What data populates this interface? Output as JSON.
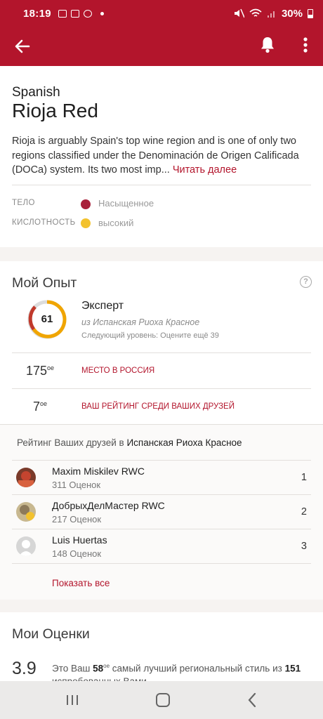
{
  "status_bar": {
    "time": "18:19",
    "battery": "30%"
  },
  "wine": {
    "origin": "Spanish",
    "name": "Rioja Red",
    "description": "Rioja is arguably Spain's top wine region and is one of only two regions classified under the Denominación de Origen Calificada (DOCa) system. Its two most imp...",
    "read_more": "Читать далее",
    "traits": [
      {
        "label": "ТЕЛО",
        "value": "Насыщенное",
        "color": "#a8203a"
      },
      {
        "label": "КИСЛОТНОСТЬ",
        "value": "высокий",
        "color": "#f3c22e"
      }
    ]
  },
  "experience": {
    "title": "Мой Опыт",
    "help_symbol": "?",
    "level_number": "61",
    "level_progress": 0.6,
    "level_name": "Эксперт",
    "level_from": "из Испанская Риоха Красное",
    "level_next": "Следующий уровень: Оцените ещё 39",
    "rank_country": {
      "value": "175",
      "suffix": "ое",
      "label": "МЕСТО В РОССИЯ"
    },
    "rank_friends": {
      "value": "7",
      "suffix": "ое",
      "label": "ВАШ РЕЙТИНГ СРЕДИ ВАШИХ ДРУЗЕЙ"
    }
  },
  "friends": {
    "title_prefix": "Рейтинг Ваших друзей в ",
    "title_style": "Испанская Риоха Красное",
    "list": [
      {
        "name": "Maxim Miskilev RWC",
        "ratings": "311 Оценок",
        "rank": "1"
      },
      {
        "name": "ДобрыхДелМастер RWC",
        "ratings": "217 Оценок",
        "rank": "2"
      },
      {
        "name": "Luis Huertas",
        "ratings": "148 Оценок",
        "rank": "3"
      }
    ],
    "show_all": "Показать все"
  },
  "my_ratings": {
    "title": "Мои Оценки",
    "score": "3.9",
    "desc_part1": "Это Ваш ",
    "desc_ordinal": "58",
    "desc_ordinal_suffix": "ое",
    "desc_part2": " самый лучший региональный стиль из ",
    "desc_total": "151",
    "desc_part3": " испробованных Вами"
  },
  "icons": {
    "back": "arrow-left-icon",
    "notifications": "bell-icon",
    "menu": "more-vertical-icon",
    "help": "help-circle-icon"
  },
  "colors": {
    "brand": "#b3152c",
    "gauge_orange": "#f0a500",
    "gauge_grey": "#dcdcdc",
    "gauge_red": "#c0392b"
  }
}
